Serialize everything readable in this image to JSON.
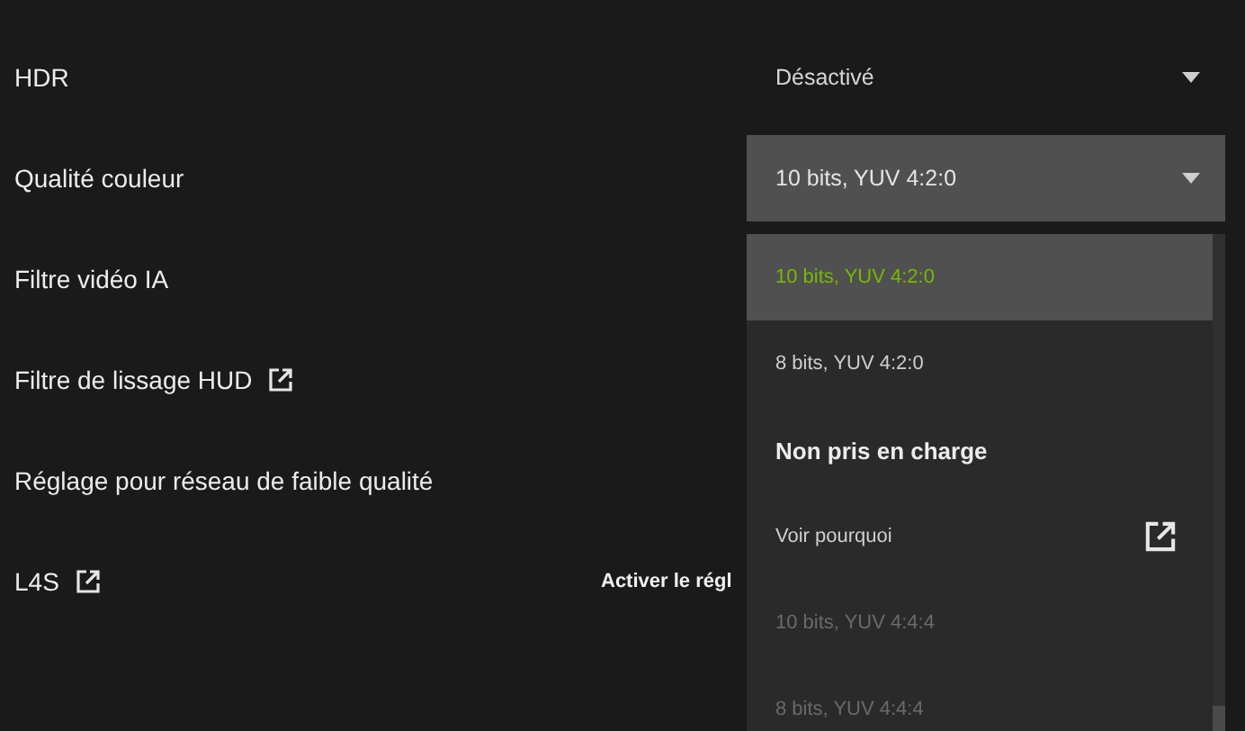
{
  "settings": [
    {
      "label": "HDR",
      "external_link": false,
      "control": {
        "kind": "dropdown",
        "value": "Désactivé",
        "expanded": false
      }
    },
    {
      "label": "Qualité couleur",
      "external_link": false,
      "control": {
        "kind": "dropdown",
        "value": "10 bits, YUV 4:2:0",
        "expanded": true
      }
    },
    {
      "label": "Filtre vidéo IA",
      "external_link": false
    },
    {
      "label": "Filtre de lissage HUD",
      "external_link": true
    },
    {
      "label": "Réglage pour réseau de faible qualité",
      "external_link": false
    },
    {
      "label": "L4S",
      "external_link": true,
      "control": {
        "kind": "text",
        "value": "Activer le régl"
      }
    }
  ],
  "dropdown_menu": {
    "items": [
      {
        "kind": "option",
        "label": "10 bits, YUV 4:2:0",
        "selected": true,
        "disabled": false
      },
      {
        "kind": "option",
        "label": "8 bits, YUV 4:2:0",
        "selected": false,
        "disabled": false
      },
      {
        "kind": "header",
        "label": "Non pris en charge"
      },
      {
        "kind": "link",
        "label": "Voir pourquoi"
      },
      {
        "kind": "option",
        "label": "10 bits, YUV 4:4:4",
        "selected": false,
        "disabled": true
      },
      {
        "kind": "option",
        "label": "8 bits, YUV 4:4:4",
        "selected": false,
        "disabled": true
      }
    ]
  }
}
